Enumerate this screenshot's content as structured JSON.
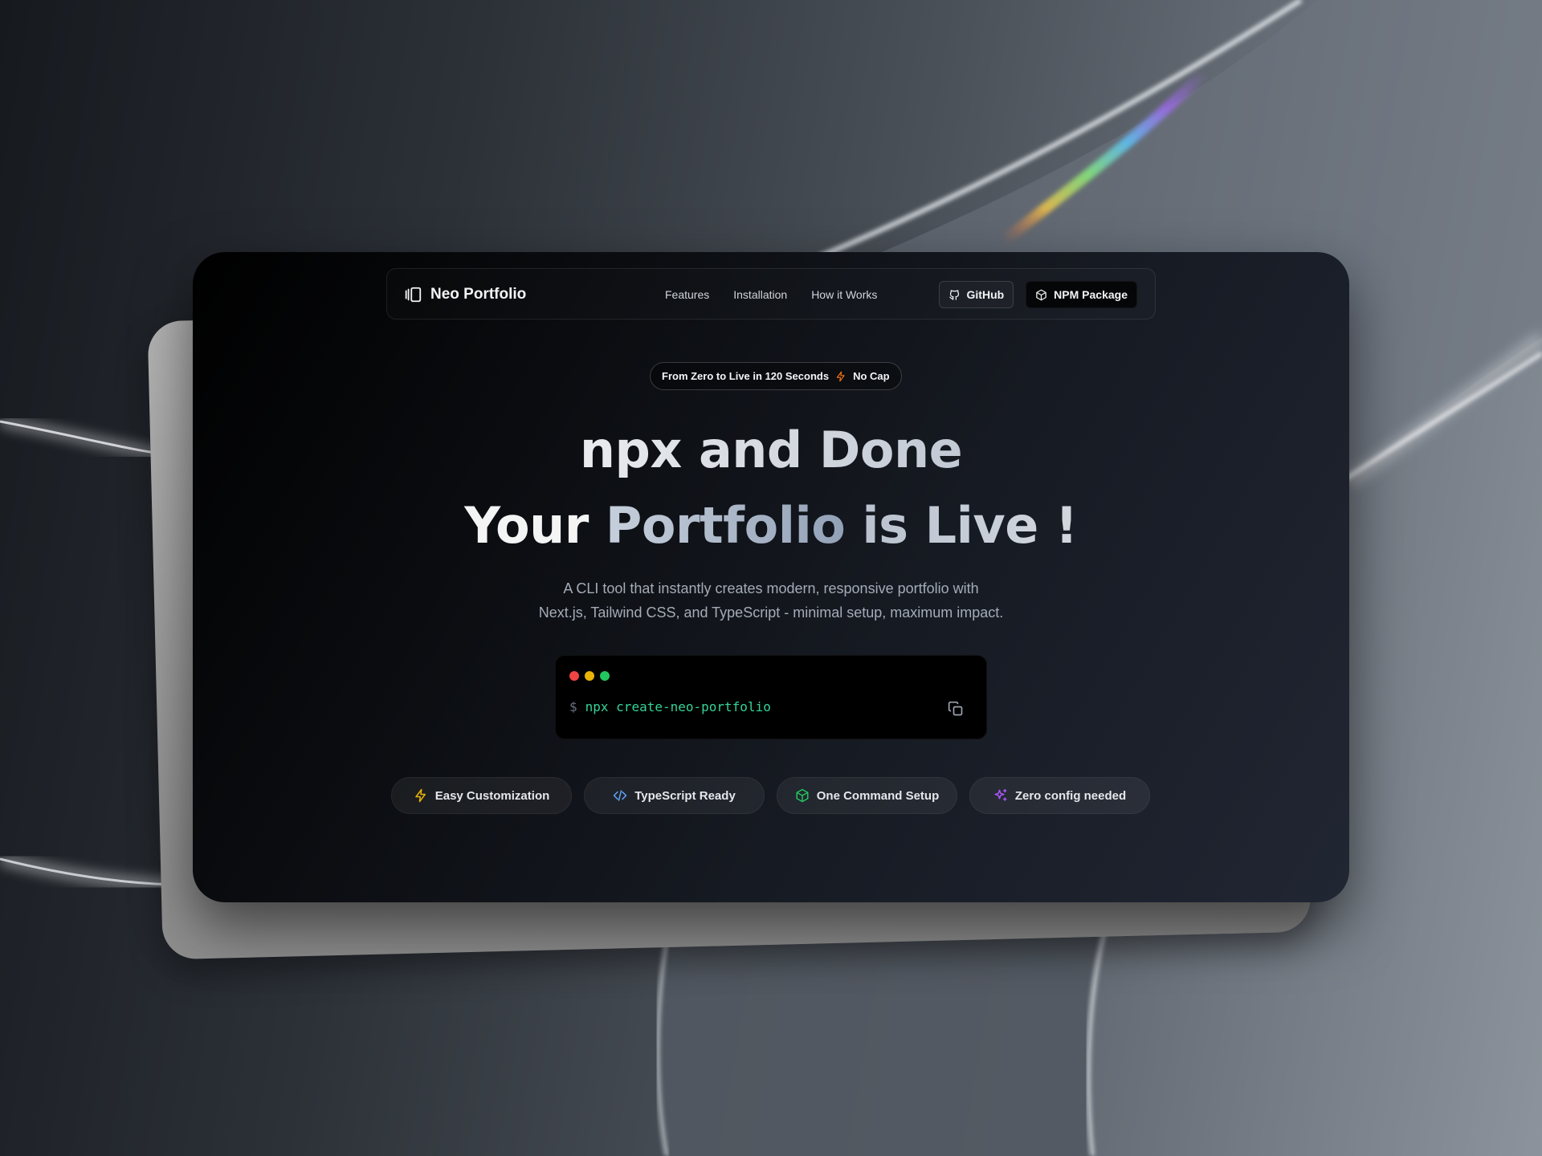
{
  "nav": {
    "brand": "Neo Portfolio",
    "links": [
      "Features",
      "Installation",
      "How it Works"
    ],
    "github_label": "GitHub",
    "npm_label": "NPM Package"
  },
  "badge": {
    "left_text": "From Zero to Live in 120 Seconds",
    "right_text": "No Cap",
    "icon": "lightning-icon"
  },
  "hero": {
    "line1": "npx and Done",
    "line2_start": "Your ",
    "line2_accent": "Portfolio",
    "line2_end": " is Live !",
    "subtitle_line1": "A CLI tool that instantly creates modern, responsive portfolio with",
    "subtitle_line2": "Next.js, Tailwind CSS, and TypeScript - minimal setup, maximum impact."
  },
  "terminal": {
    "prompt": "$",
    "command": "npx create-neo-portfolio",
    "dot_colors": [
      "#ef4444",
      "#eab308",
      "#22c55e"
    ]
  },
  "features": [
    {
      "label": "Easy Customization",
      "icon": "lightning-icon",
      "color": "#eab308"
    },
    {
      "label": "TypeScript Ready",
      "icon": "code-icon",
      "color": "#60a5fa"
    },
    {
      "label": "One Command Setup",
      "icon": "package-icon",
      "color": "#22c55e"
    },
    {
      "label": "Zero config needed",
      "icon": "sparkles-icon",
      "color": "#a855f7"
    }
  ],
  "colors": {
    "accent_orange": "#f97316",
    "command_green": "#34d399"
  }
}
